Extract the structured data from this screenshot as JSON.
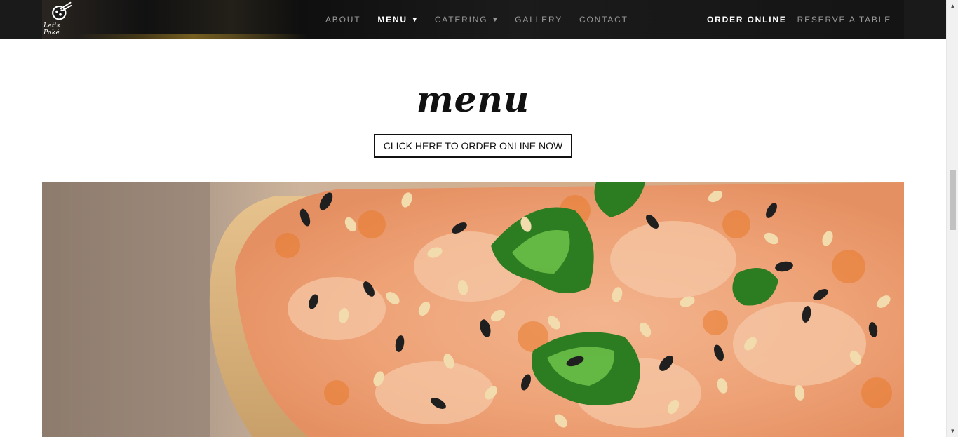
{
  "brand": {
    "logo_text": "Let's Poké"
  },
  "nav": {
    "items": [
      {
        "label": "ABOUT",
        "has_caret": false,
        "active": false
      },
      {
        "label": "MENU",
        "has_caret": true,
        "active": true
      },
      {
        "label": "CATERING",
        "has_caret": true,
        "active": false
      },
      {
        "label": "GALLERY",
        "has_caret": false,
        "active": false
      },
      {
        "label": "CONTACT",
        "has_caret": false,
        "active": false
      }
    ],
    "caret_glyph": "▼",
    "order_online": "ORDER ONLINE",
    "reserve": "RESERVE A TABLE"
  },
  "main": {
    "heading": "menu",
    "cta_label": "CLICK HERE TO ORDER ONLINE NOW",
    "hero_icon": "poke-bowl-photo"
  },
  "colors": {
    "nav_bg": "#1a1a1a",
    "nav_text": "#9a9a9a",
    "nav_active": "#ffffff",
    "heading": "#111111"
  }
}
